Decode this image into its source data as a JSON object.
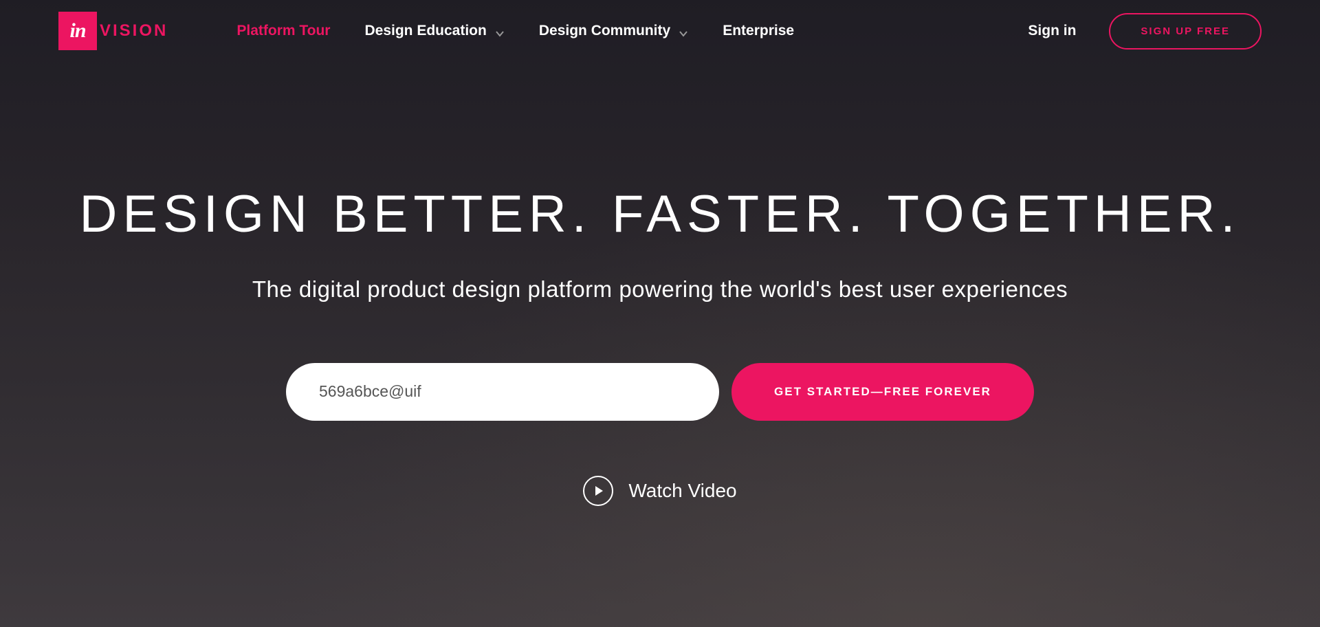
{
  "brand": {
    "logo_in": "in",
    "logo_text": "VISION"
  },
  "nav": {
    "items": [
      {
        "label": "Platform Tour",
        "active": true,
        "dropdown": false
      },
      {
        "label": "Design Education",
        "active": false,
        "dropdown": true
      },
      {
        "label": "Design Community",
        "active": false,
        "dropdown": true
      },
      {
        "label": "Enterprise",
        "active": false,
        "dropdown": false
      }
    ]
  },
  "header": {
    "sign_in": "Sign in",
    "signup": "SIGN UP FREE"
  },
  "hero": {
    "title": "DESIGN BETTER. FASTER. TOGETHER.",
    "subtitle": "The digital product design platform powering the world's best user experiences",
    "email_value": "569a6bce@uif",
    "cta_button": "GET STARTED—FREE FOREVER",
    "watch_video": "Watch Video"
  },
  "colors": {
    "accent": "#ec1561"
  }
}
